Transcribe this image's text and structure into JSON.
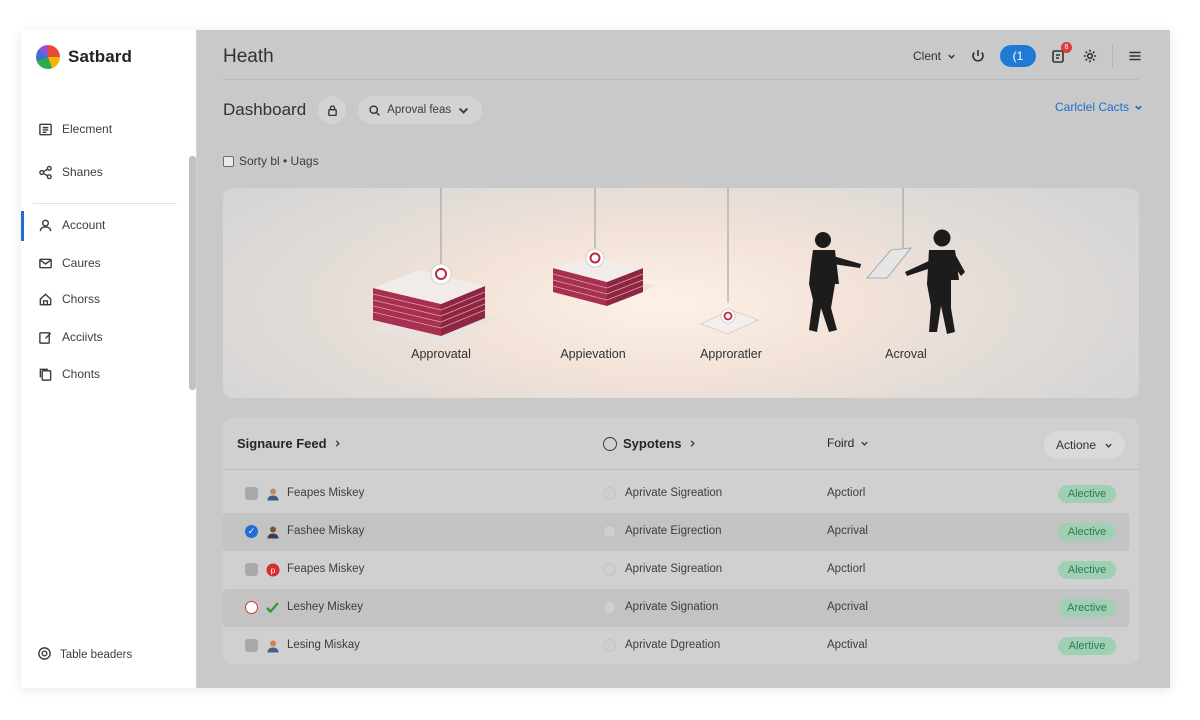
{
  "brand": {
    "name": "Satbard"
  },
  "sidebar": {
    "items": [
      {
        "label": "Elecment",
        "icon": "list-icon"
      },
      {
        "label": "Shanes",
        "icon": "share-icon"
      },
      {
        "label": "Account",
        "icon": "user-icon"
      },
      {
        "label": "Caures",
        "icon": "mail-icon"
      },
      {
        "label": "Chorss",
        "icon": "home-icon"
      },
      {
        "label": "Acciivts",
        "icon": "edit-icon"
      },
      {
        "label": "Chonts",
        "icon": "copy-icon"
      }
    ],
    "active_index": 2,
    "footer_label": "Table beaders"
  },
  "header": {
    "title": "Heath",
    "client_label": "Clent",
    "pill_label": "(1",
    "notification_count": "6"
  },
  "dashboard": {
    "title": "Dashboard",
    "search_label": "Aproval feas",
    "right_link": "Carlclel Cacts"
  },
  "filter": {
    "label": "Sorty bl • Uags"
  },
  "hero": {
    "steps": [
      {
        "label": "Approvatal"
      },
      {
        "label": "Appievation"
      },
      {
        "label": "Approratler"
      },
      {
        "label": "Acroval"
      }
    ]
  },
  "table": {
    "headers": {
      "name": "Signaure Feed",
      "type": "Sypotens",
      "folder": "Foird",
      "actions": "Actione"
    },
    "rows": [
      {
        "name": "Feapes Miskey",
        "signature": "Aprivate Sigreation",
        "folder": "Apctiorl",
        "status": "Alective",
        "avatar": "person-avatar-icon",
        "selected": false
      },
      {
        "name": "Fashee Miskay",
        "signature": "Aprivate Eigrection",
        "folder": "Apcrival",
        "status": "Alective",
        "avatar": "person-avatar-icon",
        "selected": true
      },
      {
        "name": "Feapes Miskey",
        "signature": "Aprivate Sigreation",
        "folder": "Apctiorl",
        "status": "Alective",
        "avatar": "red-p-icon",
        "selected": false
      },
      {
        "name": "Leshey Miskey",
        "signature": "Aprivate Signation",
        "folder": "Apcrival",
        "status": "Arective",
        "avatar": "green-check-icon",
        "selected": false
      },
      {
        "name": "Lesing Miskay",
        "signature": "Aprivate Dgreation",
        "folder": "Apctival",
        "status": "Alertive",
        "avatar": "person-avatar-icon",
        "selected": false
      }
    ]
  },
  "colors": {
    "accent": "#1f7ad6",
    "link": "#1b6fd0",
    "status_bg": "#9fd0b4",
    "status_text": "#2d7a52",
    "document_stack": "#a8304e"
  }
}
